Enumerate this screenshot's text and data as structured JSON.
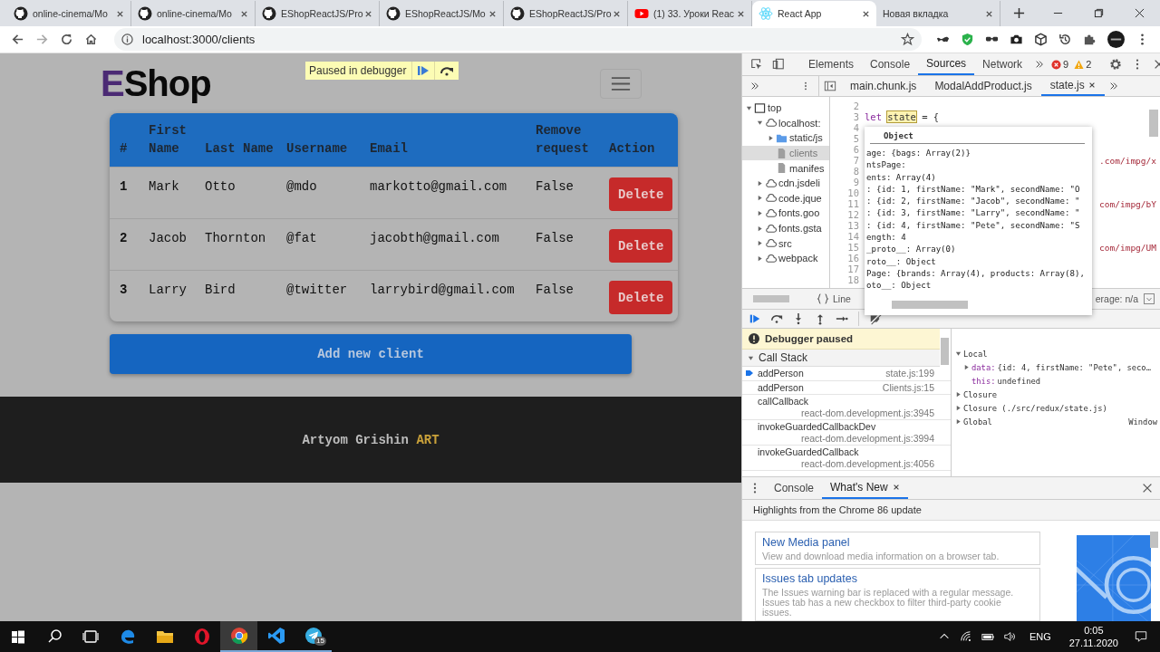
{
  "browser": {
    "tabs": [
      {
        "title": "online-cinema/Mo",
        "kind": "github",
        "selected": false
      },
      {
        "title": "online-cinema/Mo",
        "kind": "github",
        "selected": false
      },
      {
        "title": "EShopReactJS/Pro",
        "kind": "github",
        "selected": false
      },
      {
        "title": "EShopReactJS/Mo",
        "kind": "github",
        "selected": false
      },
      {
        "title": "EShopReactJS/Pro",
        "kind": "github",
        "selected": false
      },
      {
        "title": "(1) 33. Уроки Reac",
        "kind": "youtube",
        "selected": false
      },
      {
        "title": "React App",
        "kind": "react",
        "selected": true
      },
      {
        "title": "Новая вкладка",
        "kind": "blank",
        "selected": false
      }
    ],
    "address": "localhost:3000/clients"
  },
  "page": {
    "logo": {
      "initial": "E",
      "rest": "Shop"
    },
    "debugger_banner": "Paused in debugger",
    "table": {
      "columns": [
        "#",
        "First Name",
        "Last Name",
        "Username",
        "Email",
        "Remove request",
        "Action"
      ],
      "rows": [
        {
          "cells": [
            "1",
            "Mark",
            "Otto",
            "@mdo",
            "markotto@gmail.com",
            "False"
          ],
          "action": "Delete"
        },
        {
          "cells": [
            "2",
            "Jacob",
            "Thornton",
            "@fat",
            "jacobth@gmail.com",
            "False"
          ],
          "action": "Delete"
        },
        {
          "cells": [
            "3",
            "Larry",
            "Bird",
            "@twitter",
            "larrybird@gmail.com",
            "False"
          ],
          "action": "Delete"
        }
      ]
    },
    "add_button": "Add new client",
    "footer": {
      "name": "Artyom Grishin",
      "accent": "ART"
    }
  },
  "devtools": {
    "panel_tabs": [
      {
        "label": "Elements",
        "selected": false
      },
      {
        "label": "Console",
        "selected": false
      },
      {
        "label": "Sources",
        "selected": true
      },
      {
        "label": "Network",
        "selected": false
      }
    ],
    "errors": "9",
    "warnings": "2",
    "file_tabs": [
      {
        "label": "main.chunk.js",
        "selected": false
      },
      {
        "label": "ModalAddProduct.js",
        "selected": false
      },
      {
        "label": "state.js",
        "selected": true
      }
    ],
    "navigator": [
      {
        "label": "top",
        "kind": "frame",
        "expanded": true,
        "selected": false,
        "children": [
          {
            "label": "localhost:",
            "kind": "domain",
            "expanded": true,
            "selected": false,
            "children": [
              {
                "label": "static/js",
                "kind": "folder",
                "expanded": false,
                "selected": false
              },
              {
                "label": "clients",
                "kind": "file",
                "selected": true
              },
              {
                "label": "manifes",
                "kind": "file",
                "selected": false
              }
            ]
          },
          {
            "label": "cdn.jsdeli",
            "kind": "domain",
            "expanded": false,
            "selected": false
          },
          {
            "label": "code.jque",
            "kind": "domain",
            "expanded": false,
            "selected": false
          },
          {
            "label": "fonts.goo",
            "kind": "domain",
            "expanded": false,
            "selected": false
          },
          {
            "label": "fonts.gsta",
            "kind": "domain",
            "expanded": false,
            "selected": false
          },
          {
            "label": "src",
            "kind": "domain",
            "expanded": false,
            "selected": false
          },
          {
            "label": "webpack",
            "kind": "domain",
            "expanded": false,
            "selected": false
          }
        ]
      }
    ],
    "code_lines": [
      {
        "num": "2"
      },
      {
        "num": "3",
        "prefix": "let ",
        "highlight": "state",
        "suffix": " = {"
      },
      {
        "num": "4"
      },
      {
        "num": "5"
      },
      {
        "num": "6"
      },
      {
        "num": "7",
        "right": ".com/impg/x"
      },
      {
        "num": "8"
      },
      {
        "num": "9"
      },
      {
        "num": "10"
      },
      {
        "num": "11",
        "right": "com/impg/bY"
      },
      {
        "num": "12"
      },
      {
        "num": "13"
      },
      {
        "num": "14"
      },
      {
        "num": "15",
        "right": "com/impg/UM"
      },
      {
        "num": "16"
      },
      {
        "num": "17"
      },
      {
        "num": "18"
      }
    ],
    "status_line": "Line",
    "status_coverage": "erage: n/a",
    "tooltip": {
      "title": "Object",
      "lines": [
        "age: {bags: Array(2)}",
        "ntsPage:",
        "ents: Array(4)",
        ": {id: 1, firstName: \"Mark\", secondName: \"O",
        ": {id: 2, firstName: \"Jacob\", secondName: \"",
        ": {id: 3, firstName: \"Larry\", secondName: \"",
        ": {id: 4, firstName: \"Pete\", secondName: \"S",
        "ength: 4",
        "_proto__: Array(0)",
        "roto__: Object",
        "Page: {brands: Array(4), products: Array(8),",
        "oto__: Object"
      ]
    },
    "paused_message": "Debugger paused",
    "call_stack_title": "Call Stack",
    "call_stack": [
      {
        "fn": "addPerson",
        "location": "state.js:199",
        "current": true
      },
      {
        "fn": "addPerson",
        "location": "Clients.js:15",
        "current": false
      },
      {
        "fn": "callCallback",
        "location": "react-dom.development.js:3945",
        "current": false
      },
      {
        "fn": "invokeGuardedCallbackDev",
        "location": "react-dom.development.js:3994",
        "current": false
      },
      {
        "fn": "invokeGuardedCallback",
        "location": "react-dom.development.js:4056",
        "current": false
      }
    ],
    "scope": [
      {
        "label": "Local",
        "expanded": true,
        "children": [
          {
            "label": "data:",
            "value": "{id: 4, firstName: \"Pete\", seco…",
            "expanded": false
          },
          {
            "label": "this:",
            "value": "undefined"
          }
        ]
      },
      {
        "label": "Closure",
        "expanded": false
      },
      {
        "label": "Closure (./src/redux/state.js)",
        "expanded": false
      },
      {
        "label": "Global",
        "value": "Window",
        "expanded": false
      }
    ],
    "drawer": {
      "tabs": [
        {
          "label": "Console",
          "selected": false
        },
        {
          "label": "What's New",
          "selected": true
        }
      ],
      "heading": "Highlights from the Chrome 86 update",
      "cards": [
        {
          "title": "New Media panel",
          "text": "View and download media information on a browser tab."
        },
        {
          "title": "Issues tab updates",
          "text": "The Issues warning bar is replaced with a regular message. Issues tab has a new checkbox to filter third-party cookie issues."
        }
      ]
    }
  },
  "taskbar": {
    "apps": [
      {
        "kind": "edge",
        "open": false,
        "focused": false
      },
      {
        "kind": "explorer",
        "open": false,
        "focused": false
      },
      {
        "kind": "opera",
        "open": false,
        "focused": false
      },
      {
        "kind": "chrome",
        "open": true,
        "focused": true
      },
      {
        "kind": "vscode",
        "open": true,
        "focused": false
      },
      {
        "kind": "telegram",
        "open": true,
        "focused": false,
        "badge": "15"
      }
    ],
    "language": "ENG",
    "time": "0:05",
    "date": "27.11.2020"
  }
}
